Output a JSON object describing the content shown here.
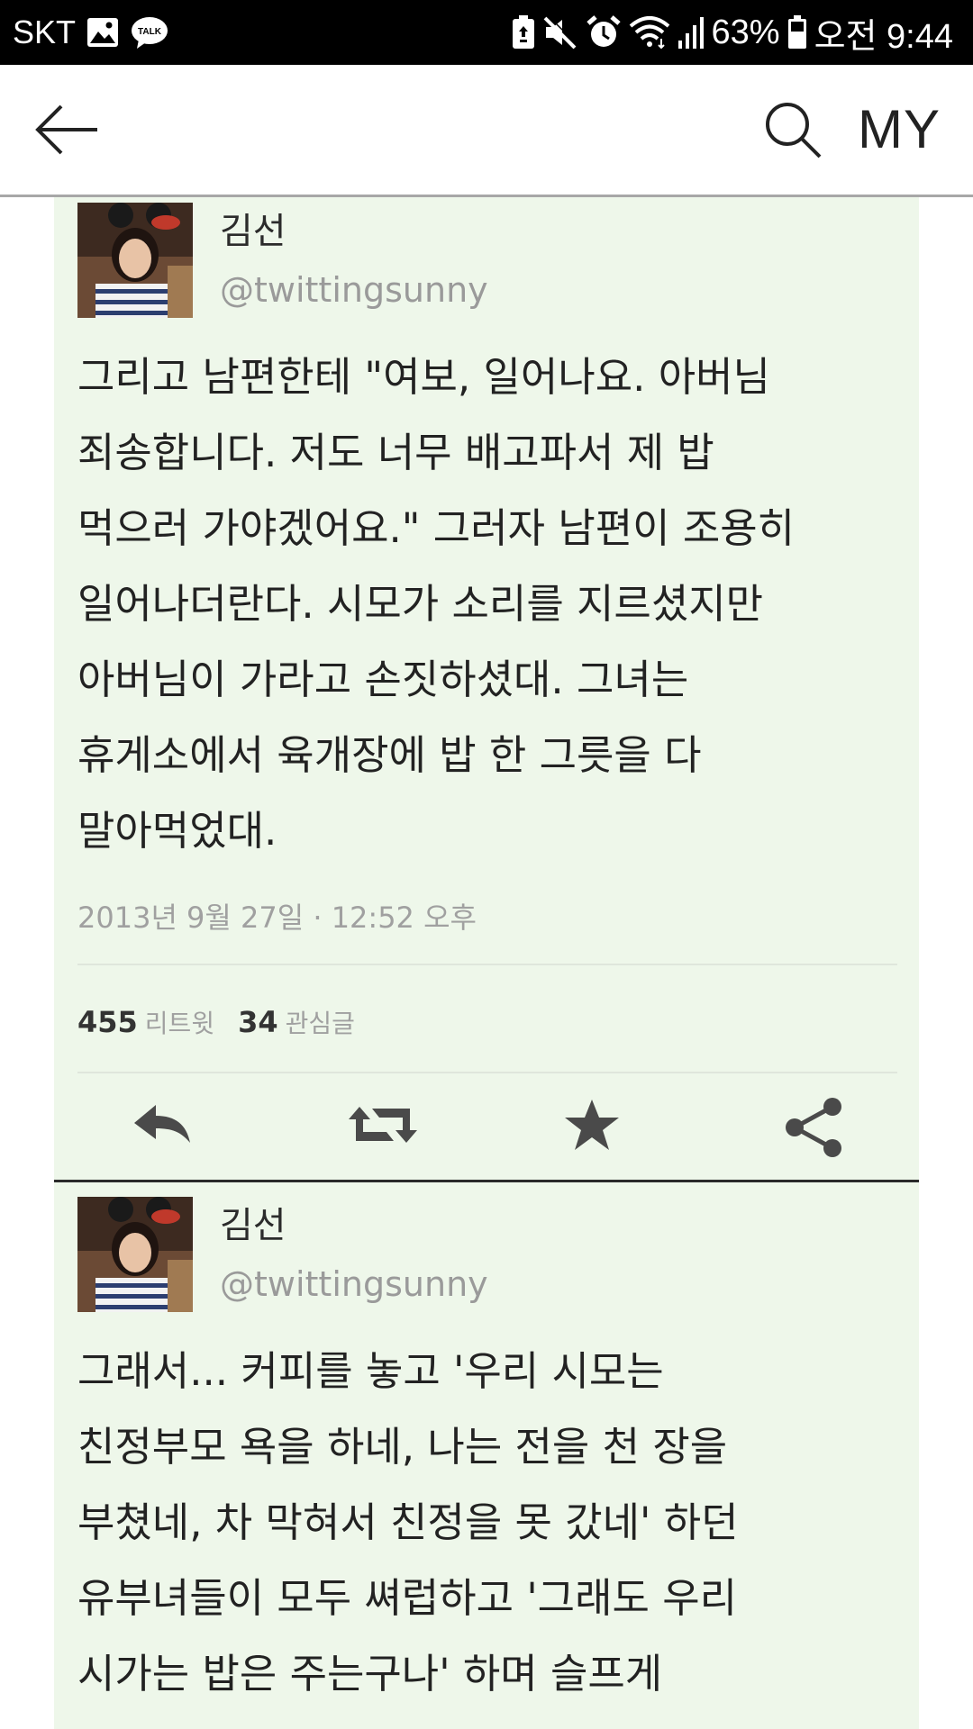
{
  "status_bar": {
    "carrier": "SKT",
    "battery_percent": "63%",
    "time": "오전 9:44",
    "left_icons": [
      "gallery-icon",
      "kakaotalk-icon"
    ],
    "right_icons": [
      "battery-saver-icon",
      "mute-icon",
      "alarm-icon",
      "wifi-icon",
      "signal-icon",
      "battery-icon"
    ],
    "talk_badge": "TALK"
  },
  "app_bar": {
    "back_icon": "back-arrow-icon",
    "search_icon": "search-icon",
    "my_label": "MY"
  },
  "tweets": [
    {
      "display_name": "김선",
      "handle": "@twittingsunny",
      "body": "그리고 남편한테 \"여보, 일어나요. 아버님\n죄송합니다. 저도 너무 배고파서 제 밥\n먹으러 가야겠어요.\" 그러자 남편이 조용히\n일어나더란다. 시모가 소리를 지르셨지만\n아버님이 가라고 손짓하셨대. 그녀는\n휴게소에서 육개장에 밥 한 그릇을 다\n말아먹었대.",
      "timestamp": "2013년 9월 27일 · 12:52 오후",
      "retweets": "455",
      "retweets_label": "리트윗",
      "favorites": "34",
      "favorites_label": "관심글",
      "actions": [
        "reply-icon",
        "retweet-icon",
        "star-icon",
        "share-icon"
      ]
    },
    {
      "display_name": "김선",
      "handle": "@twittingsunny",
      "body": "그래서... 커피를 놓고 '우리 시모는\n친정부모 욕을 하네, 나는 전을 천 장을\n부쳤네, 차 막혀서 친정을 못 갔네' 하던\n유부녀들이 모두 쎠럽하고 '그래도 우리\n시가는 밥은 주는구나' 하며 슬프게"
    }
  ],
  "colors": {
    "status_bar_bg": "#000000",
    "card_bg": "#eef7ea",
    "text": "#222222",
    "muted": "#9a9a9a"
  }
}
